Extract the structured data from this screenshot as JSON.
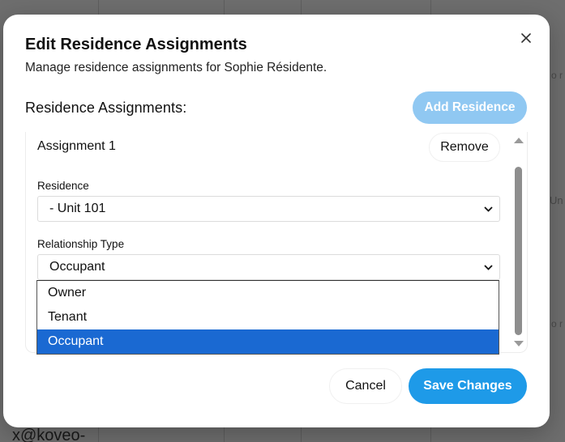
{
  "background": {
    "email_fragment": "x@koveo-",
    "right_fragment_1": "o r",
    "right_fragment_2": "Un",
    "right_fragment_3": "o r",
    "right_fragment_4": "o r"
  },
  "modal": {
    "title": "Edit Residence Assignments",
    "description": "Manage residence assignments for Sophie Résidente.",
    "close_icon": "close-icon",
    "section_title": "Residence Assignments:",
    "add_button_label": "Add Residence",
    "assignment": {
      "title": "Assignment 1",
      "remove_label": "Remove",
      "residence_label": "Residence",
      "residence_value": "- Unit 101",
      "relationship_label": "Relationship Type",
      "relationship_value": "Occupant"
    },
    "dropdown_options": [
      {
        "label": "Owner",
        "selected": false
      },
      {
        "label": "Tenant",
        "selected": false
      },
      {
        "label": "Occupant",
        "selected": true
      }
    ],
    "cancel_label": "Cancel",
    "save_label": "Save Changes"
  },
  "colors": {
    "primary": "#1e9ae8",
    "primary_disabled": "#90c8f2",
    "option_highlight": "#1a69d2",
    "overlay": "#6e6e6e"
  }
}
